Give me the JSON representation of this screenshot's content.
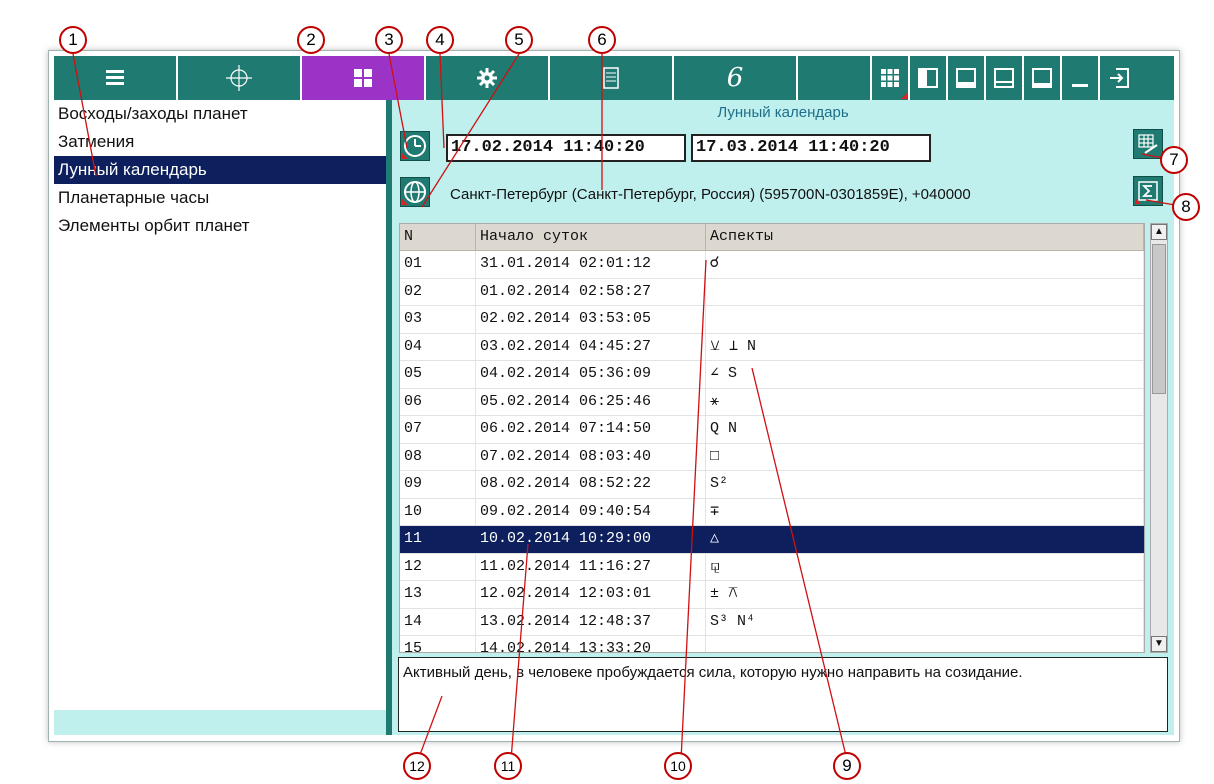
{
  "toolbar": {
    "buttons": [
      {
        "icon": "list-icon"
      },
      {
        "icon": "crosshair-icon"
      },
      {
        "icon": "grid-icon",
        "active": true
      },
      {
        "icon": "gear-icon"
      },
      {
        "icon": "document-icon"
      },
      {
        "icon": "logo-icon",
        "label": "6"
      }
    ],
    "window_buttons": [
      "grid-layout-icon",
      "panel-left-icon",
      "panel-bottom-icon",
      "panel-bottom-alt-icon",
      "panel-window-icon",
      "minimize-icon",
      "exit-icon"
    ]
  },
  "sidebar": {
    "items": [
      {
        "label": "Восходы/заходы планет"
      },
      {
        "label": "Затмения"
      },
      {
        "label": "Лунный календарь",
        "selected": true
      },
      {
        "label": "Планетарные часы"
      },
      {
        "label": "Элементы орбит планет"
      }
    ]
  },
  "main": {
    "title": "Лунный календарь",
    "date_from": "17.02.2014 11:40:20",
    "date_to": "17.03.2014 11:40:20",
    "location": "Санкт-Петербург (Санкт-Петербург, Россия) (595700N-0301859E), +040000",
    "table": {
      "headers": [
        "N",
        "Начало суток",
        "Аспекты"
      ],
      "rows": [
        {
          "n": "01",
          "start": "31.01.2014 02:01:12",
          "aspects": "☌"
        },
        {
          "n": "02",
          "start": "01.02.2014 02:58:27",
          "aspects": ""
        },
        {
          "n": "03",
          "start": "02.02.2014 03:53:05",
          "aspects": ""
        },
        {
          "n": "04",
          "start": "03.02.2014 04:45:27",
          "aspects": "⚺ ⊥ N"
        },
        {
          "n": "05",
          "start": "04.02.2014 05:36:09",
          "aspects": "∠ S"
        },
        {
          "n": "06",
          "start": "05.02.2014 06:25:46",
          "aspects": "⚹"
        },
        {
          "n": "07",
          "start": "06.02.2014 07:14:50",
          "aspects": "Q N"
        },
        {
          "n": "08",
          "start": "07.02.2014 08:03:40",
          "aspects": "□"
        },
        {
          "n": "09",
          "start": "08.02.2014 08:52:22",
          "aspects": "S²"
        },
        {
          "n": "10",
          "start": "09.02.2014 09:40:54",
          "aspects": "∓"
        },
        {
          "n": "11",
          "start": "10.02.2014 10:29:00",
          "aspects": "△",
          "selected": true
        },
        {
          "n": "12",
          "start": "11.02.2014 11:16:27",
          "aspects": "⚼"
        },
        {
          "n": "13",
          "start": "12.02.2014 12:03:01",
          "aspects": "± ⚻"
        },
        {
          "n": "14",
          "start": "13.02.2014 12:48:37",
          "aspects": "S³ N⁴"
        },
        {
          "n": "15",
          "start": "14.02.2014 13:33:20",
          "aspects": ""
        }
      ]
    },
    "description": "Активный день, в человеке пробуждается сила, которую нужно направить на созидание."
  },
  "callouts": [
    "1",
    "2",
    "3",
    "4",
    "5",
    "6",
    "7",
    "8",
    "9",
    "10",
    "11",
    "12"
  ],
  "colors": {
    "teal": "#1f7a72",
    "active_tab": "#9b33c7",
    "selection": "#0d1f5c",
    "panel_bg": "#bff0ee",
    "callout": "#c00000"
  }
}
